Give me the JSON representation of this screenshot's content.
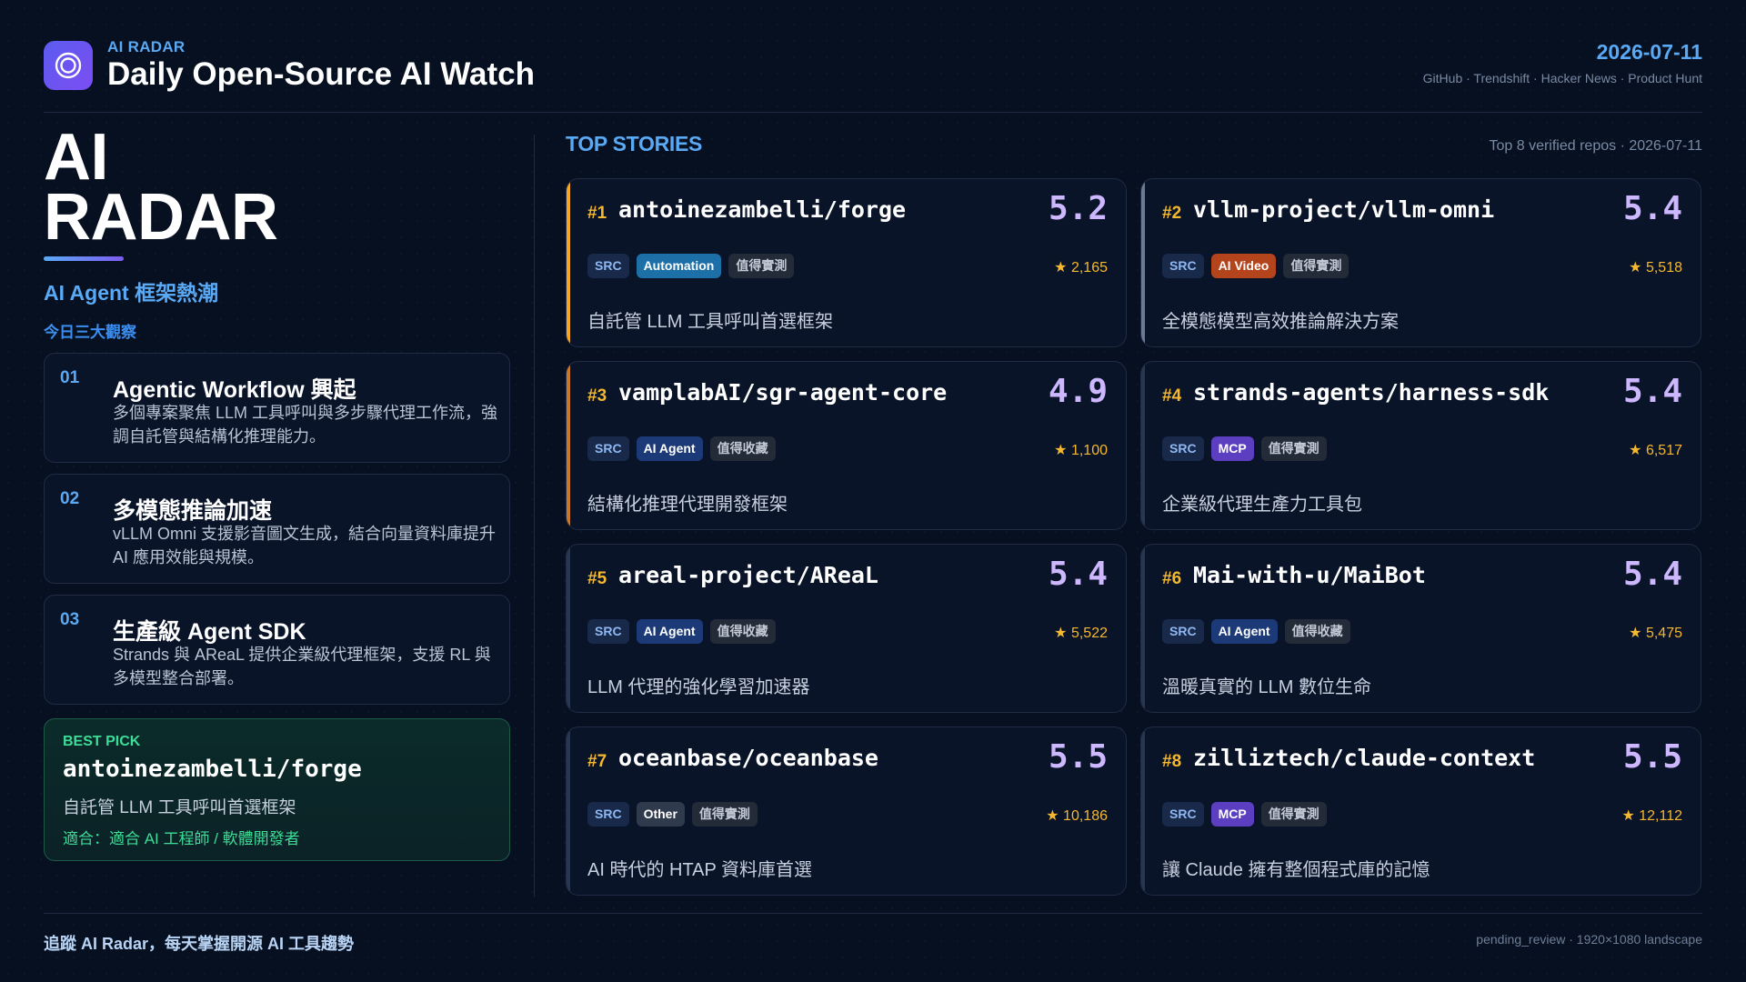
{
  "header": {
    "kicker": "AI RADAR",
    "title": "Daily Open-Source AI Watch",
    "date": "2026-07-11",
    "sources": "GitHub · Trendshift · Hacker News · Product Hunt",
    "logo_icon": "radar-ring-icon"
  },
  "hero": {
    "title_line1": "AI",
    "title_line2": "RADAR",
    "subtitle": "AI Agent 框架熱潮",
    "insights_label": "今日三大觀察"
  },
  "insights": [
    {
      "num": "01",
      "title": "Agentic Workflow 興起",
      "desc": "多個專案聚焦 LLM 工具呼叫與多步驟代理工作流，強調自託管與結構化推理能力。"
    },
    {
      "num": "02",
      "title": "多模態推論加速",
      "desc": "vLLM Omni 支援影音圖文生成，結合向量資料庫提升 AI 應用效能與規模。"
    },
    {
      "num": "03",
      "title": "生產級 Agent SDK",
      "desc": "Strands 與 AReaL 提供企業級代理框架，支援 RL 與多模型整合部署。"
    }
  ],
  "best_pick": {
    "label": "BEST PICK",
    "name": "antoinezambelli/forge",
    "desc": "自託管 LLM 工具呼叫首選框架",
    "fit": "適合：適合 AI 工程師 / 軟體開發者"
  },
  "stories": {
    "title": "TOP STORIES",
    "meta": "Top 8 verified repos · 2026-07-11"
  },
  "cards": [
    {
      "rank": "#1",
      "repo": "antoinezambelli/forge",
      "score": "5.2",
      "src": "SRC",
      "category": "Automation",
      "note": "值得實測",
      "stars": "★ 2,165",
      "desc": "自託管 LLM 工具呼叫首選框架",
      "accent": "#f5a623",
      "cat_color": "#1d6fa8"
    },
    {
      "rank": "#2",
      "repo": "vllm-project/vllm-omni",
      "score": "5.4",
      "src": "SRC",
      "category": "AI Video",
      "note": "值得實測",
      "stars": "★ 5,518",
      "desc": "全模態模型高效推論解決方案",
      "accent": "#6b7a92",
      "cat_color": "#b4441c"
    },
    {
      "rank": "#3",
      "repo": "vamplabAI/sgr-agent-core",
      "score": "4.9",
      "src": "SRC",
      "category": "AI Agent",
      "note": "值得收藏",
      "stars": "★ 1,100",
      "desc": "結構化推理代理開發框架",
      "accent": "#c9772a",
      "cat_color": "#1d3a78"
    },
    {
      "rank": "#4",
      "repo": "strands-agents/harness-sdk",
      "score": "5.4",
      "src": "SRC",
      "category": "MCP",
      "note": "值得實測",
      "stars": "★ 6,517",
      "desc": "企業級代理生產力工具包",
      "accent": "#2a3750",
      "cat_color": "#5b3fc0"
    },
    {
      "rank": "#5",
      "repo": "areal-project/AReaL",
      "score": "5.4",
      "src": "SRC",
      "category": "AI Agent",
      "note": "值得收藏",
      "stars": "★ 5,522",
      "desc": "LLM 代理的強化學習加速器",
      "accent": "#2a3750",
      "cat_color": "#1d3a78"
    },
    {
      "rank": "#6",
      "repo": "Mai-with-u/MaiBot",
      "score": "5.4",
      "src": "SRC",
      "category": "AI Agent",
      "note": "值得收藏",
      "stars": "★ 5,475",
      "desc": "溫暖真實的 LLM 數位生命",
      "accent": "#2a3750",
      "cat_color": "#1d3a78"
    },
    {
      "rank": "#7",
      "repo": "oceanbase/oceanbase",
      "score": "5.5",
      "src": "SRC",
      "category": "Other",
      "note": "值得實測",
      "stars": "★ 10,186",
      "desc": "AI 時代的 HTAP 資料庫首選",
      "accent": "#2a3750",
      "cat_color": "#2f3a4d"
    },
    {
      "rank": "#8",
      "repo": "zilliztech/claude-context",
      "score": "5.5",
      "src": "SRC",
      "category": "MCP",
      "note": "值得實測",
      "stars": "★ 12,112",
      "desc": "讓 Claude 擁有整個程式庫的記憶",
      "accent": "#2a3750",
      "cat_color": "#5b3fc0"
    }
  ],
  "footer": {
    "left": "追蹤 AI Radar，每天掌握開源 AI 工具趨勢",
    "right": "pending_review · 1920×1080 landscape"
  }
}
